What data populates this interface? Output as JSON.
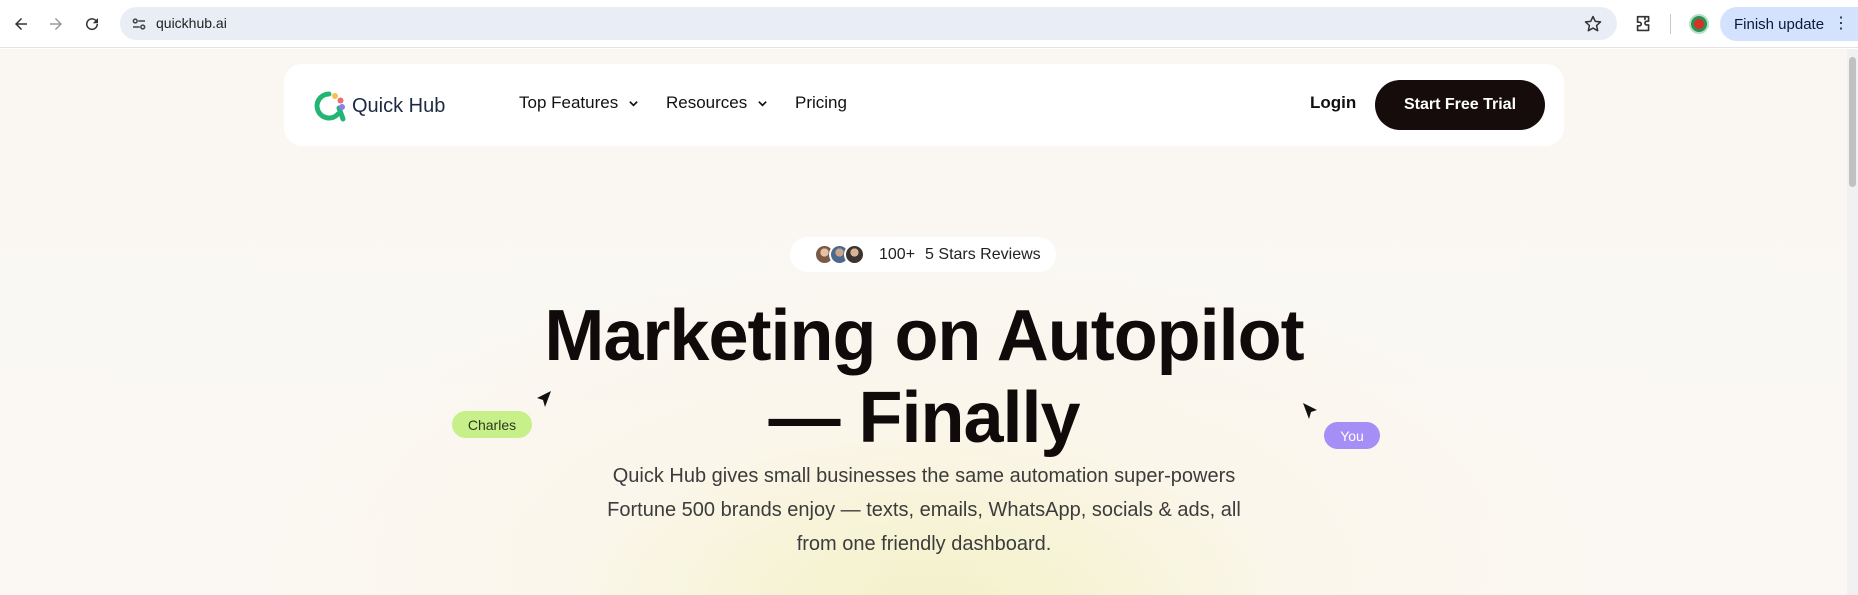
{
  "browser": {
    "url": "quickhub.ai",
    "update_label": "Finish update",
    "menu_glyph": "⋮"
  },
  "nav": {
    "logo_text": "Quick Hub",
    "menu": [
      "Top Features",
      "Resources",
      "Pricing"
    ],
    "login_label": "Login",
    "cta_label": "Start Free Trial"
  },
  "hero": {
    "reviews_count": "100+",
    "reviews_label": "5 Stars Reviews",
    "headline_line1": "Marketing on Autopilot",
    "headline_line2": "— Finally",
    "tag_left": "Charles",
    "tag_right": "You",
    "subtitle_line1": "Quick Hub gives small businesses the same automation super-powers",
    "subtitle_line2": "Fortune 500 brands enjoy — texts, emails, WhatsApp, socials & ads, all",
    "subtitle_line3": "from one friendly dashboard."
  },
  "colors": {
    "cta_bg": "#160c0c",
    "tag_left_bg": "#c8f08a",
    "tag_right_bg": "#a58ef5",
    "update_bg": "#d3e3fd"
  },
  "icons": [
    "back-icon",
    "forward-icon",
    "reload-icon",
    "site-settings-icon",
    "bookmark-star-icon",
    "extensions-icon",
    "profile-icon",
    "chevron-down-icon",
    "cursor-arrow-icon"
  ]
}
